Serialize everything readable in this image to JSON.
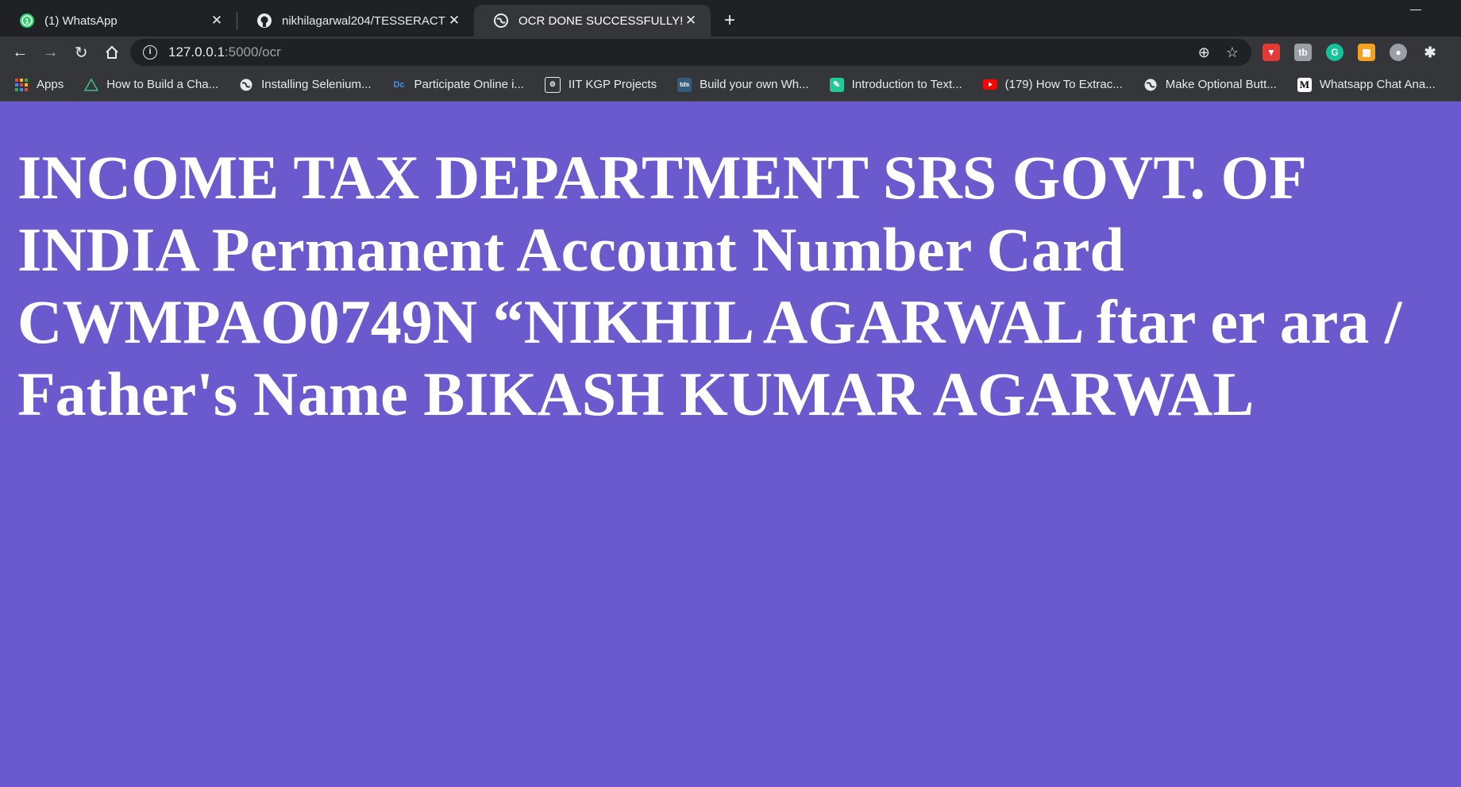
{
  "tabs": [
    {
      "title": "(1) WhatsApp",
      "icon": "whatsapp-icon",
      "active": false
    },
    {
      "title": "nikhilagarwal204/TESSERACT",
      "icon": "github-icon",
      "active": false
    },
    {
      "title": "OCR DONE SUCCESSFULLY!",
      "icon": "globe-icon",
      "active": true
    }
  ],
  "address_bar": {
    "host": "127.0.0.1",
    "path": ":5000/ocr"
  },
  "bookmarks": [
    {
      "label": "Apps",
      "icon": "apps-grid-icon"
    },
    {
      "label": "How to Build a Cha...",
      "icon": "triangle-icon"
    },
    {
      "label": "Installing Selenium...",
      "icon": "globe-icon"
    },
    {
      "label": "Participate Online i...",
      "icon": "dc-icon"
    },
    {
      "label": "IIT KGP Projects",
      "icon": "iit-logo-icon"
    },
    {
      "label": "Build your own Wh...",
      "icon": "tds-icon"
    },
    {
      "label": "Introduction to Text...",
      "icon": "teal-square-icon"
    },
    {
      "label": "(179) How To Extrac...",
      "icon": "youtube-icon"
    },
    {
      "label": "Make Optional Butt...",
      "icon": "globe-icon"
    },
    {
      "label": "Whatsapp Chat Ana...",
      "icon": "medium-icon"
    }
  ],
  "page": {
    "background": "#6a5acd",
    "ocr_text": "INCOME TAX DEPARTMENT SRS GOVT. OF INDIA Permanent Account Number Card CWMPAO0749N “NIKHIL AGARWAL ftar er ara / Father's Name BIKASH KUMAR AGARWAL"
  }
}
